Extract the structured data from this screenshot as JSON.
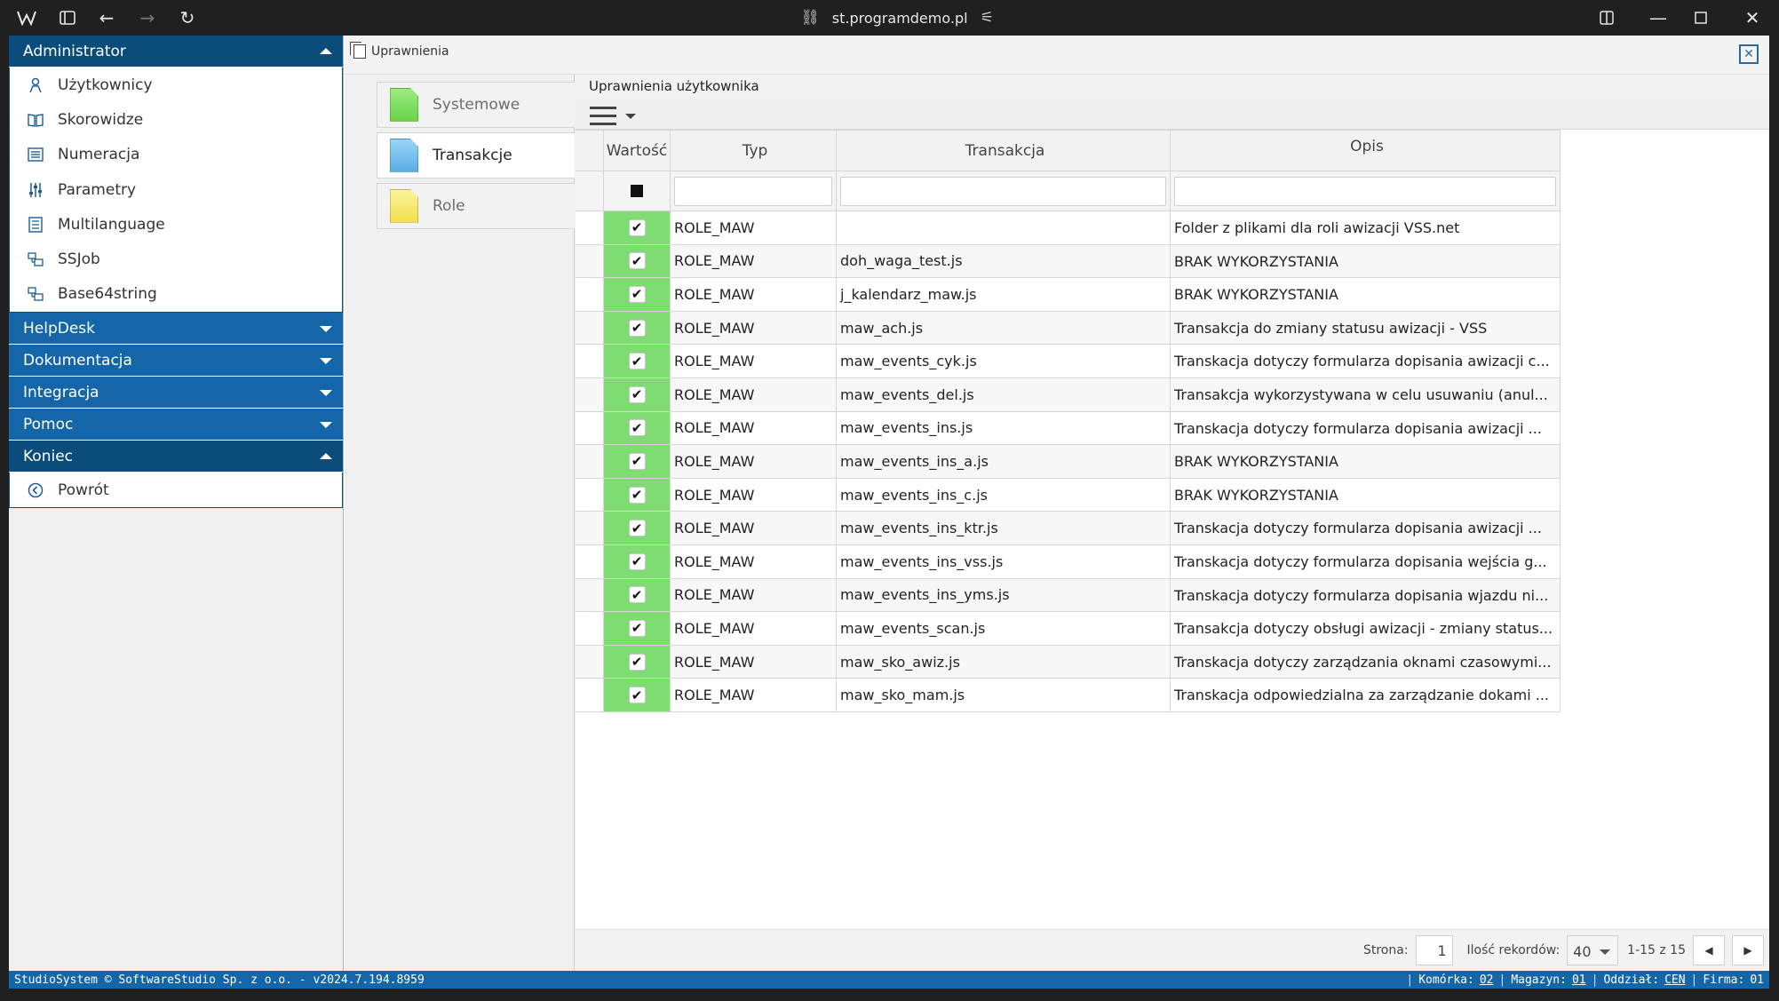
{
  "browser": {
    "url": "st.programdemo.pl",
    "icons": [
      "app-logo-icon",
      "sidebar-toggle-icon",
      "back-icon",
      "forward-icon",
      "reload-icon",
      "link-icon",
      "tune-icon",
      "split-view-icon",
      "minimize-icon",
      "maximize-icon",
      "close-icon"
    ]
  },
  "sidebar": {
    "sections": [
      {
        "label": "Administrator",
        "expanded": true
      },
      {
        "label": "HelpDesk",
        "expanded": false
      },
      {
        "label": "Dokumentacja",
        "expanded": false
      },
      {
        "label": "Integracja",
        "expanded": false
      },
      {
        "label": "Pomoc",
        "expanded": false
      },
      {
        "label": "Koniec",
        "expanded": true
      }
    ],
    "admin_items": [
      {
        "label": "Użytkownicy",
        "icon": "user-icon"
      },
      {
        "label": "Skorowidze",
        "icon": "book-icon"
      },
      {
        "label": "Numeracja",
        "icon": "numbered-list-icon"
      },
      {
        "label": "Parametry",
        "icon": "sliders-icon"
      },
      {
        "label": "Multilanguage",
        "icon": "language-icon"
      },
      {
        "label": "SSJob",
        "icon": "job-icon"
      },
      {
        "label": "Base64string",
        "icon": "job-icon"
      }
    ],
    "end_items": [
      {
        "label": "Powrót",
        "icon": "back-circle-icon"
      }
    ]
  },
  "main": {
    "title": "Uprawnienia",
    "tabs": [
      {
        "label": "Systemowe",
        "color": "green",
        "active": false
      },
      {
        "label": "Transakcje",
        "color": "blue",
        "active": true
      },
      {
        "label": "Role",
        "color": "yellow",
        "active": false
      }
    ],
    "panel_title": "Uprawnienia użytkownika",
    "columns": [
      "Wartość",
      "Typ",
      "Transakcja",
      "Opis"
    ],
    "rows": [
      {
        "checked": true,
        "typ": "ROLE_MAW",
        "transakcja": "",
        "opis": "Folder z plikami dla roli awizacji VSS.net"
      },
      {
        "checked": true,
        "typ": "ROLE_MAW",
        "transakcja": "doh_waga_test.js",
        "opis": "BRAK WYKORZYSTANIA"
      },
      {
        "checked": true,
        "typ": "ROLE_MAW",
        "transakcja": "j_kalendarz_maw.js",
        "opis": "BRAK WYKORZYSTANIA"
      },
      {
        "checked": true,
        "typ": "ROLE_MAW",
        "transakcja": "maw_ach.js",
        "opis": "Transakcja do zmiany statusu awizacji - VSS"
      },
      {
        "checked": true,
        "typ": "ROLE_MAW",
        "transakcja": "maw_events_cyk.js",
        "opis": "Transkacja dotyczy formularza dopisania awizacji c..."
      },
      {
        "checked": true,
        "typ": "ROLE_MAW",
        "transakcja": "maw_events_del.js",
        "opis": "Transakcja wykorzystywana w celu usuwaniu (anul..."
      },
      {
        "checked": true,
        "typ": "ROLE_MAW",
        "transakcja": "maw_events_ins.js",
        "opis": "Transkacja dotyczy formularza dopisania awizacji ..."
      },
      {
        "checked": true,
        "typ": "ROLE_MAW",
        "transakcja": "maw_events_ins_a.js",
        "opis": "BRAK WYKORZYSTANIA"
      },
      {
        "checked": true,
        "typ": "ROLE_MAW",
        "transakcja": "maw_events_ins_c.js",
        "opis": "BRAK WYKORZYSTANIA"
      },
      {
        "checked": true,
        "typ": "ROLE_MAW",
        "transakcja": "maw_events_ins_ktr.js",
        "opis": "Transkacja dotyczy formularza dopisania awizacji ..."
      },
      {
        "checked": true,
        "typ": "ROLE_MAW",
        "transakcja": "maw_events_ins_vss.js",
        "opis": "Transkacja dotyczy formularza dopisania wejścia g..."
      },
      {
        "checked": true,
        "typ": "ROLE_MAW",
        "transakcja": "maw_events_ins_yms.js",
        "opis": "Transkacja dotyczy formularza dopisania wjazdu ni..."
      },
      {
        "checked": true,
        "typ": "ROLE_MAW",
        "transakcja": "maw_events_scan.js",
        "opis": "Transakcja dotyczy obsługi awizacji - zmiany status..."
      },
      {
        "checked": true,
        "typ": "ROLE_MAW",
        "transakcja": "maw_sko_awiz.js",
        "opis": "Transkacja dotyczy zarządzania oknami czasowymi..."
      },
      {
        "checked": true,
        "typ": "ROLE_MAW",
        "transakcja": "maw_sko_mam.js",
        "opis": "Transkacja odpowiedzialna za zarządzanie dokami ..."
      }
    ],
    "pager": {
      "page_label": "Strona:",
      "page_value": "1",
      "records_label": "Ilość rekordów:",
      "records_value": "40",
      "range_text": "1-15 z 15"
    }
  },
  "status": {
    "left": "StudioSystem © SoftwareStudio Sp. z o.o. - v2024.7.194.8959",
    "komorka_label": "Komórka:",
    "komorka_value": "02",
    "magazyn_label": "Magazyn:",
    "magazyn_value": "01",
    "oddzial_label": "Oddział:",
    "oddzial_value": "CEN",
    "firma_label": "Firma:",
    "firma_value": "01"
  },
  "colors": {
    "nav_dark": "#0a4c7c",
    "nav_blue": "#1466a8",
    "checked_cell": "#7fdc73"
  }
}
